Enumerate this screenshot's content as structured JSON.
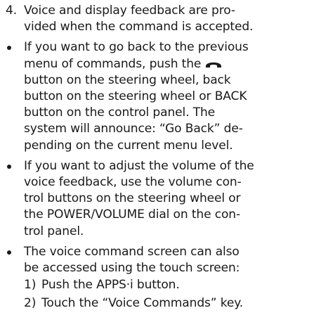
{
  "step4": {
    "number": "4.",
    "lines": [
      "Voice and display feedback are pro-",
      "vided when the command is accepted."
    ]
  },
  "bullet_back": {
    "line1": "If you want to go back to the previous",
    "line2_before_icon": "menu of commands, push the",
    "icon": "phone-handset-icon",
    "lines_after": [
      "button on the steering wheel, back",
      "button on the steering wheel or BACK",
      "button on the control panel. The",
      "system will announce: “Go Back” de-",
      "pending on the current menu level."
    ]
  },
  "bullet_volume": {
    "lines": [
      "If you want to adjust the volume of the",
      "voice feedback, use the volume con-",
      "trol buttons on the steering wheel or",
      "the POWER/VOLUME dial on the con-",
      "trol panel."
    ]
  },
  "bullet_touch": {
    "lines": [
      "The voice command screen can also",
      "be accessed using the touch screen:"
    ],
    "substeps": [
      {
        "number": "1)",
        "text": "Push the APPS·i button."
      },
      {
        "number": "2)",
        "text": "Touch the “Voice Commands” key."
      }
    ]
  }
}
